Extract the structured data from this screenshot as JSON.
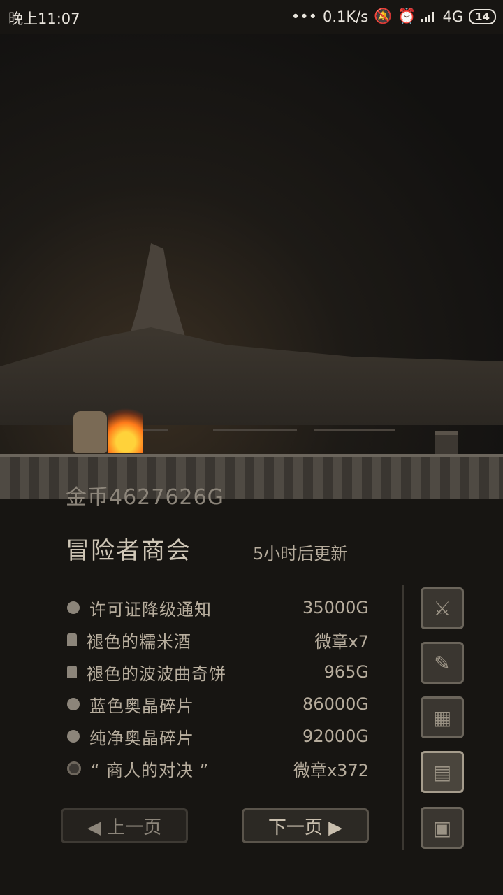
{
  "status_bar": {
    "time": "晚上11:07",
    "net_speed": "0.1K/s",
    "network": "4G",
    "battery": "14"
  },
  "gold": {
    "text": "金币4627626G"
  },
  "shop": {
    "title": "冒险者商会",
    "refresh": "5小时后更新",
    "items": [
      {
        "name": "许可证降级通知",
        "price": "35000G",
        "icon": "orb-icon"
      },
      {
        "name": "褪色的糯米酒",
        "price": "微章x7",
        "icon": "cup-icon"
      },
      {
        "name": "褪色的波波曲奇饼",
        "price": "965G",
        "icon": "cup-icon"
      },
      {
        "name": "蓝色奥晶碎片",
        "price": "86000G",
        "icon": "orb-icon"
      },
      {
        "name": "纯净奥晶碎片",
        "price": "92000G",
        "icon": "orb-icon"
      },
      {
        "name": "“ 商人的对决 ”",
        "price": "微章x372",
        "icon": "coin-icon"
      }
    ]
  },
  "side_buttons": [
    {
      "icon": "crossed-swords-icon",
      "glyph": "⚔"
    },
    {
      "icon": "quill-paper-icon",
      "glyph": "✎"
    },
    {
      "icon": "map-icon",
      "glyph": "▦"
    },
    {
      "icon": "documents-icon",
      "glyph": "▤"
    },
    {
      "icon": "computer-icon",
      "glyph": "▣"
    }
  ],
  "nav": {
    "prev": "◀ 上一页",
    "next": "下一页 ▶"
  }
}
